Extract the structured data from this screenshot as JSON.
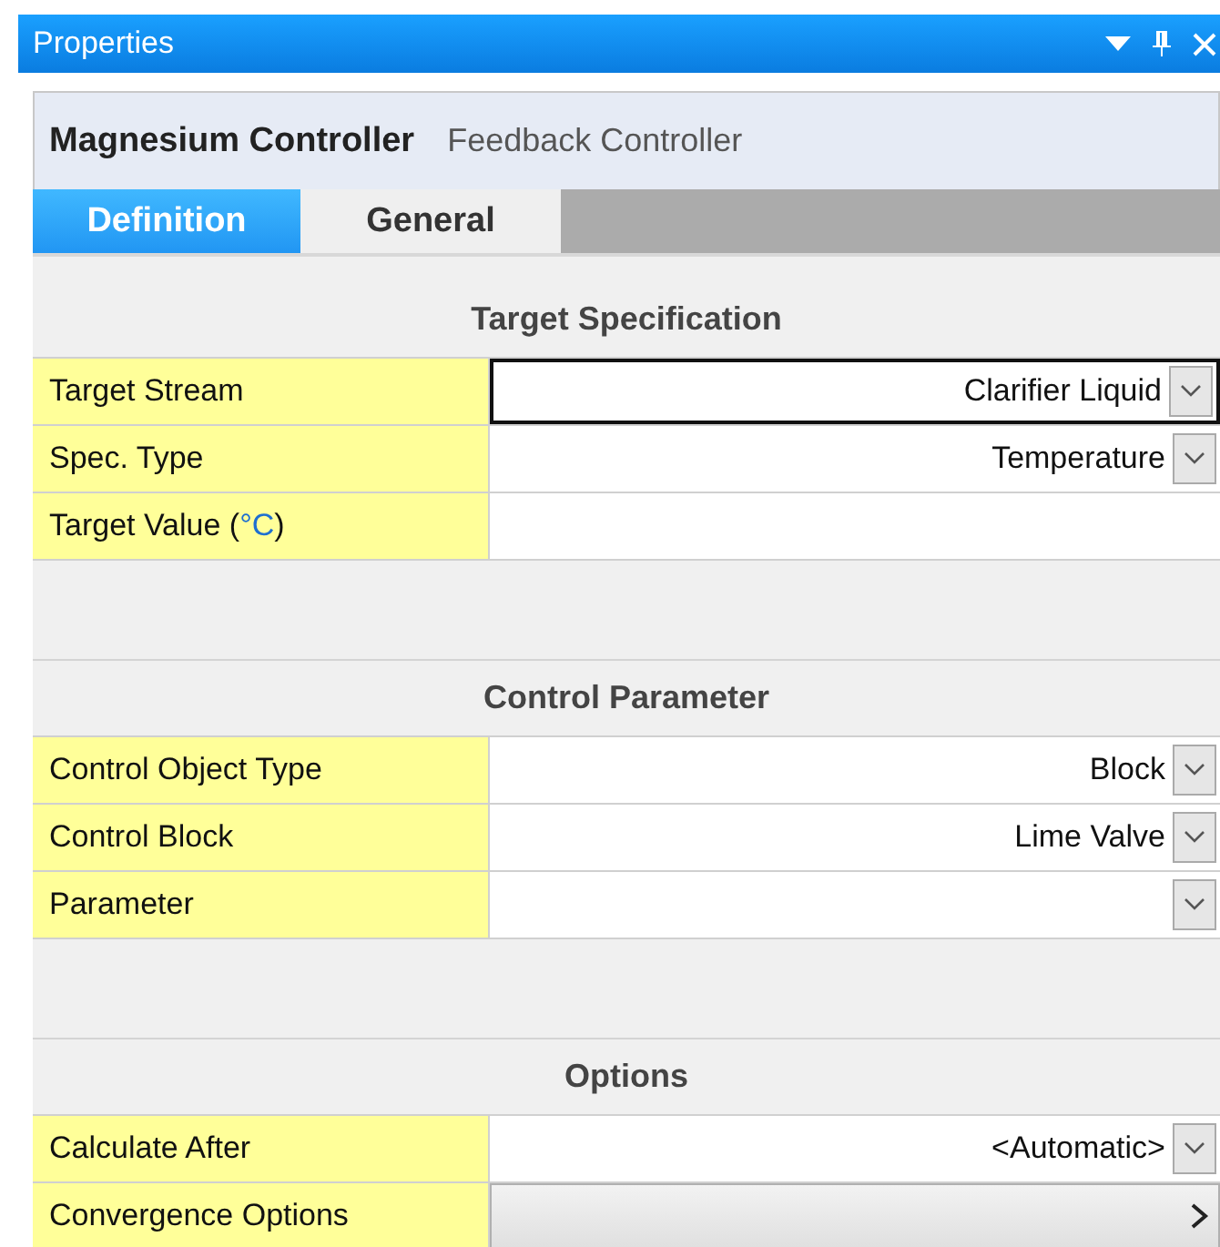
{
  "window": {
    "title": "Properties"
  },
  "header": {
    "name": "Magnesium Controller",
    "type": "Feedback Controller"
  },
  "tabs": [
    {
      "label": "Definition",
      "selected": true
    },
    {
      "label": "General",
      "selected": false
    }
  ],
  "sections": [
    {
      "title": "Target Specification",
      "rows": [
        {
          "label": "Target Stream",
          "kind": "dropdown",
          "value": "Clarifier Liquid",
          "focused": true
        },
        {
          "label": "Spec. Type",
          "kind": "dropdown",
          "value": "Temperature",
          "focused": false
        },
        {
          "label": "Target Value (",
          "unit": "°C",
          "label_tail": ")",
          "kind": "text",
          "focused": false
        }
      ]
    },
    {
      "title": "Control Parameter",
      "rows": [
        {
          "label": "Control Object Type",
          "kind": "dropdown",
          "value": "Block",
          "focused": false
        },
        {
          "label": "Control Block",
          "kind": "dropdown",
          "value": "Lime Valve",
          "focused": false
        },
        {
          "label": "Parameter",
          "kind": "dropdown",
          "focused": false
        }
      ]
    },
    {
      "title": "Options",
      "rows": [
        {
          "label": "Calculate After",
          "kind": "dropdown",
          "value": "<Automatic>",
          "focused": false
        },
        {
          "label": "Convergence Options",
          "kind": "button",
          "focused": false
        }
      ]
    }
  ]
}
